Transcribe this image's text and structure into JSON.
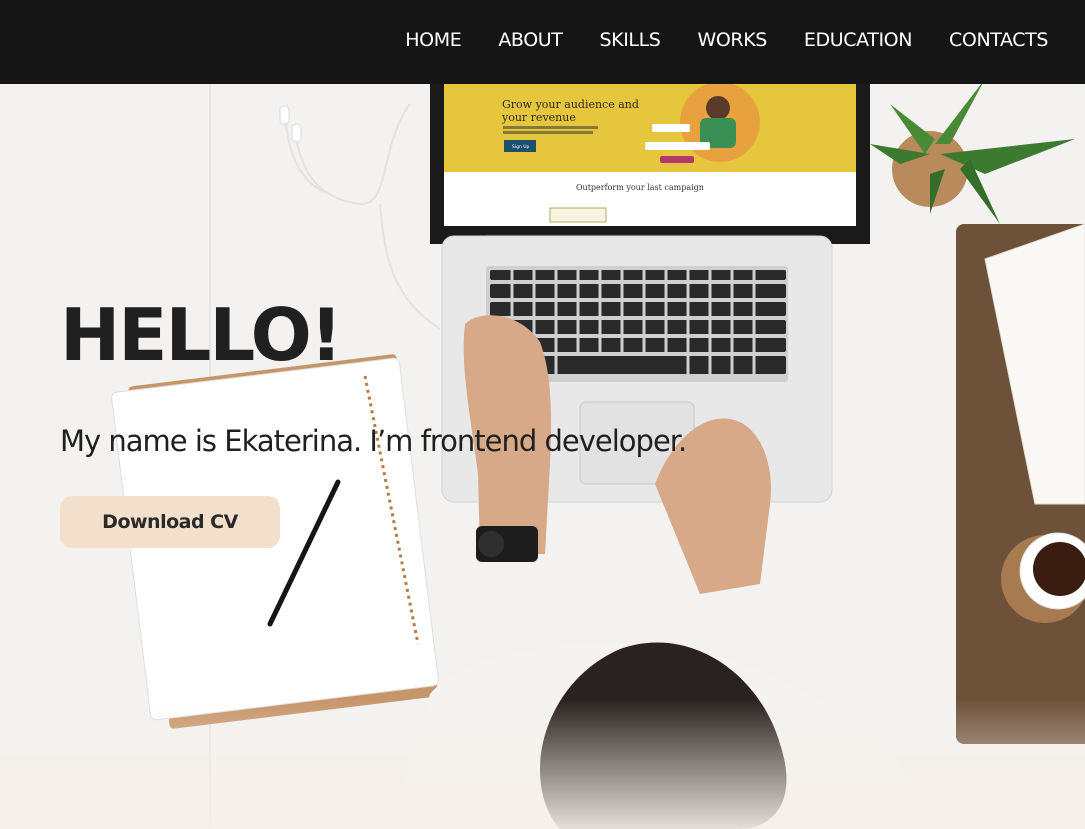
{
  "nav": {
    "items": [
      {
        "label": "HOME"
      },
      {
        "label": "ABOUT"
      },
      {
        "label": "SKILLS"
      },
      {
        "label": "WORKS"
      },
      {
        "label": "EDUCATION"
      },
      {
        "label": "CONTACTS"
      }
    ]
  },
  "hero": {
    "title": "HELLO!",
    "subtitle": "My name is Ekaterina. I’m frontend developer.",
    "cv_button": "Download CV",
    "photo": {
      "laptop_screen": {
        "headline_line1": "Grow your audience and",
        "headline_line2": "your revenue",
        "signup_label": "Sign Up",
        "section_heading": "Outperform your last campaign"
      }
    }
  },
  "colors": {
    "header_bg": "#151515",
    "nav_text": "#ffffff",
    "title_text": "#202020",
    "button_bg": "#f3e0cc",
    "screen_banner": "#e6c63d"
  }
}
